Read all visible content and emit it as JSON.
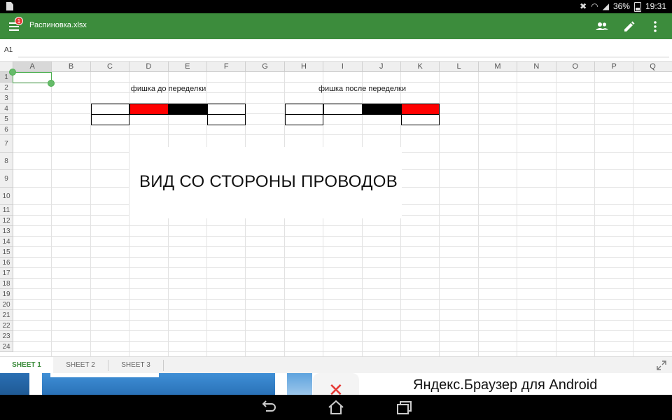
{
  "status_bar": {
    "battery": "36%",
    "time": "19:31",
    "icons": [
      "file-icon",
      "mute-icon",
      "wifi-icon",
      "signal-icon",
      "battery-icon"
    ]
  },
  "app_bar": {
    "notification_count": "1",
    "file_name": "Распиновка.xlsx",
    "accent_color": "#3c8c3c",
    "icons": [
      "menu-icon",
      "share-people-icon",
      "edit-pencil-icon",
      "more-vert-icon"
    ]
  },
  "formula_bar": {
    "cell_ref": "A1",
    "value": ""
  },
  "sheet": {
    "columns": [
      "A",
      "B",
      "C",
      "D",
      "E",
      "F",
      "G",
      "H",
      "I",
      "J",
      "K",
      "L",
      "M",
      "N",
      "O",
      "P",
      "Q"
    ],
    "rows": [
      "1",
      "2",
      "3",
      "4",
      "5",
      "6",
      "7",
      "8",
      "9",
      "10",
      "11",
      "12",
      "13",
      "14",
      "15",
      "16",
      "17",
      "18",
      "19",
      "20",
      "21",
      "22",
      "23",
      "24"
    ],
    "label_before": "фишка до переделки",
    "label_after": "фишка после переделки",
    "caption": "ВИД СО СТОРОНЫ ПРОВОДОВ",
    "connector_before": {
      "top_row": [
        "white",
        "red",
        "black",
        "white"
      ],
      "bottom_row": [
        "white",
        "",
        "",
        "white"
      ]
    },
    "connector_after": {
      "top_row": [
        "white",
        "white",
        "black",
        "red"
      ],
      "bottom_row": [
        "white",
        "",
        "",
        "white"
      ]
    }
  },
  "tabs": {
    "items": [
      "SHEET 1",
      "SHEET 2",
      "SHEET 3"
    ],
    "active": "SHEET 1"
  },
  "ad": {
    "text": "Яндекс.Браузер для Android"
  },
  "nav": {
    "icons": [
      "back-icon",
      "home-icon",
      "recents-icon"
    ]
  }
}
